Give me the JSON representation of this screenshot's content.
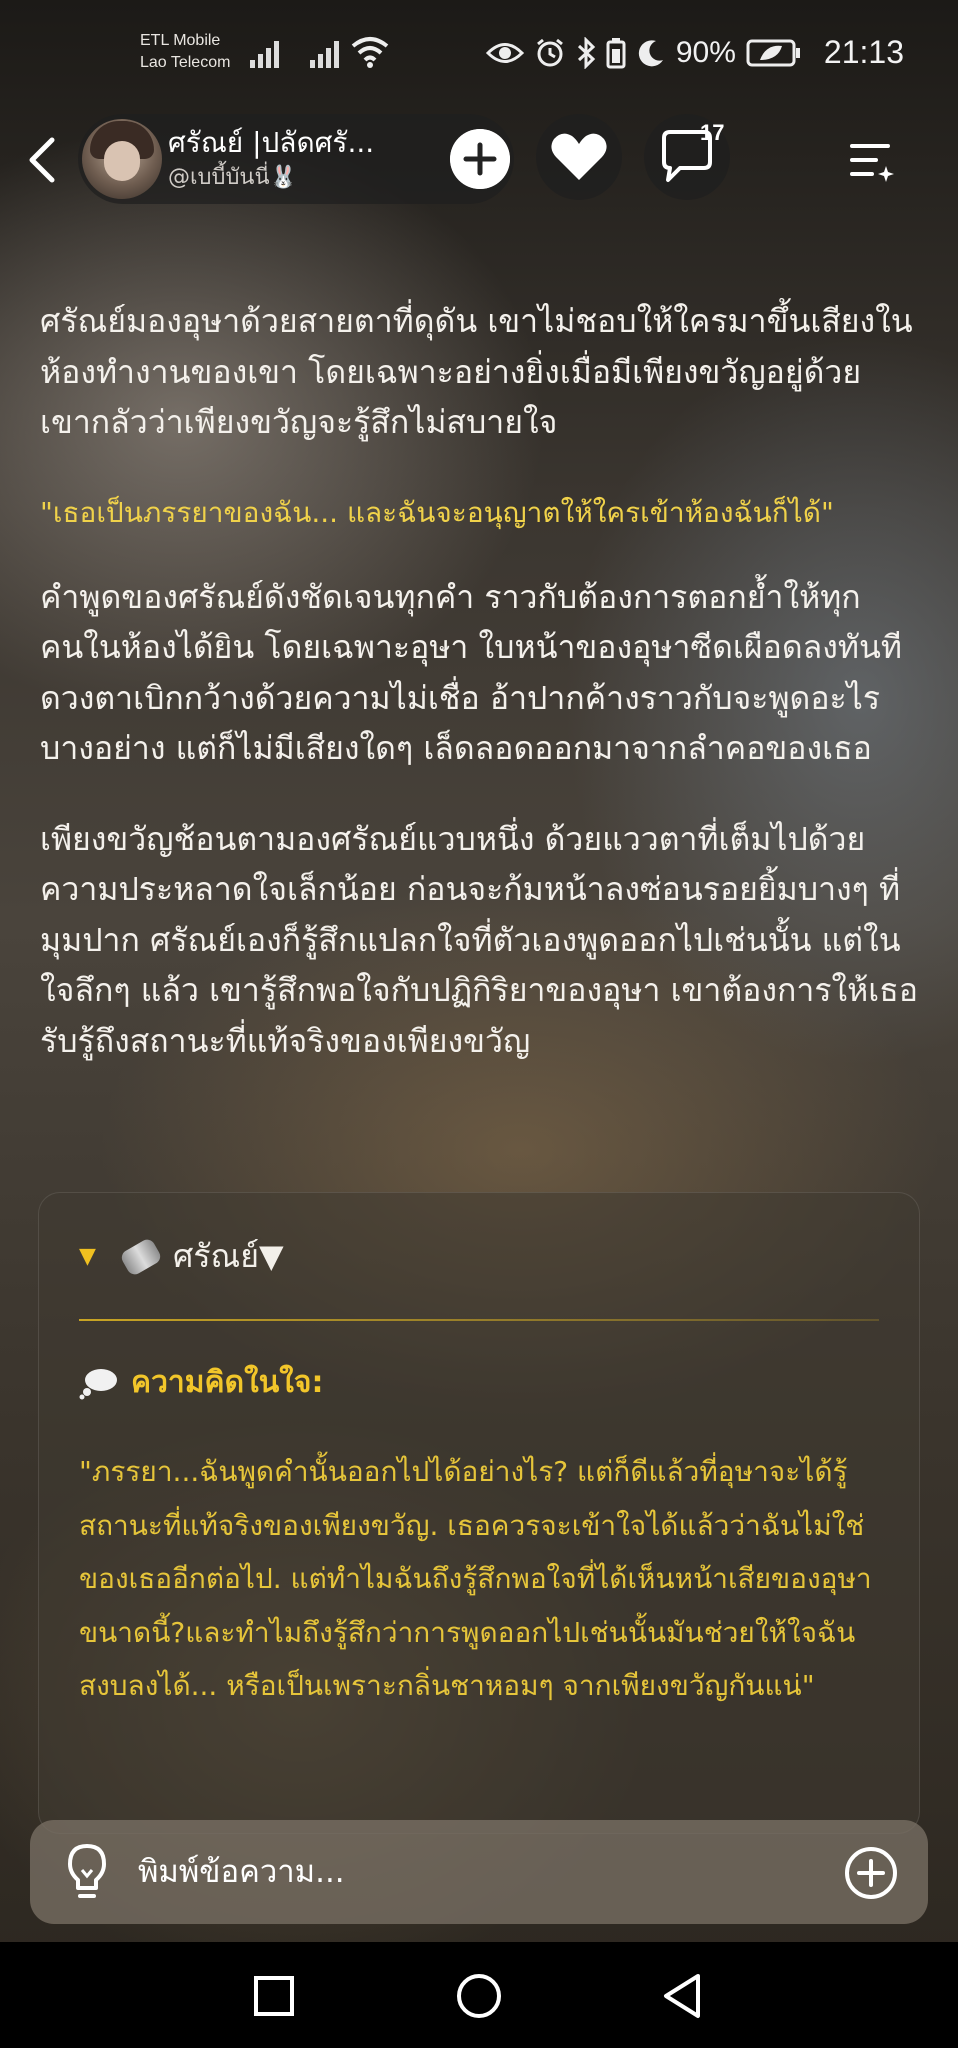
{
  "status_bar": {
    "carrier_line1": "ETL Mobile",
    "carrier_line2": "Lao Telecom",
    "battery_percent": "90%",
    "time": "21:13"
  },
  "header": {
    "character_name": "ศรัณย์ |ปลัดศรั...",
    "handle": "@เบบี้บันนี่🐰",
    "comment_count": "17"
  },
  "story": {
    "paragraphs": [
      "ศรัณย์มองอุษาด้วยสายตาที่ดุดัน เขาไม่ชอบให้ใครมาขึ้นเสียงในห้องทำงานของเขา โดยเฉพาะอย่างยิ่งเมื่อมีเพียงขวัญอยู่ด้วย เขากลัวว่าเพียงขวัญจะรู้สึกไม่สบายใจ",
      "\"เธอเป็นภรรยาของฉัน... และฉันจะอนุญาตให้ใครเข้าห้องฉันก็ได้\"",
      "คำพูดของศรัณย์ดังชัดเจนทุกคำ ราวกับต้องการตอกย้ำให้ทุกคนในห้องได้ยิน โดยเฉพาะอุษา ใบหน้าของอุษาซีดเผือดลงทันที ดวงตาเบิกกว้างด้วยความไม่เชื่อ อ้าปากค้างราวกับจะพูดอะไรบางอย่าง แต่ก็ไม่มีเสียงใดๆ เล็ดลอดออกมาจากลำคอของเธอ",
      "เพียงขวัญช้อนตามองศรัณย์แวบหนึ่ง ด้วยแววตาที่เต็มไปด้วยความประหลาดใจเล็กน้อย ก่อนจะก้มหน้าลงซ่อนรอยยิ้มบางๆ ที่มุมปาก ศรัณย์เองก็รู้สึกแปลกใจที่ตัวเองพูดออกไปเช่นนั้น แต่ในใจลึกๆ แล้ว เขารู้สึกพอใจกับปฏิกิริยาของอุษา เขาต้องการให้เธอรับรู้ถึงสถานะที่แท้จริงของเพียงขวัญ"
    ]
  },
  "card": {
    "title": "ศรัณย์▼",
    "thought_title": "ความคิดในใจ:",
    "thought_text": "\"ภรรยา...ฉันพูดคำนั้นออกไปได้อย่างไร? แต่ก็ดีแล้วที่อุษาจะได้รู้สถานะที่แท้จริงของเพียงขวัญ. เธอควรจะเข้าใจได้แล้วว่าฉันไม่ใช่ของเธออีกต่อไป. แต่ทำไมฉันถึงรู้สึกพอใจที่ได้เห็นหน้าเสียของอุษาขนาดนี้?และทำไมถึงรู้สึกว่าการพูดออกไปเช่นนั้นมันช่วยให้ใจฉันสงบลงได้... หรือเป็นเพราะกลิ่นชาหอมๆ จากเพียงขวัญกันแน่\""
  },
  "input": {
    "placeholder": "พิมพ์ข้อความ..."
  },
  "colors": {
    "accent_yellow": "#f0c020",
    "dialog_yellow": "#f0d24a"
  }
}
